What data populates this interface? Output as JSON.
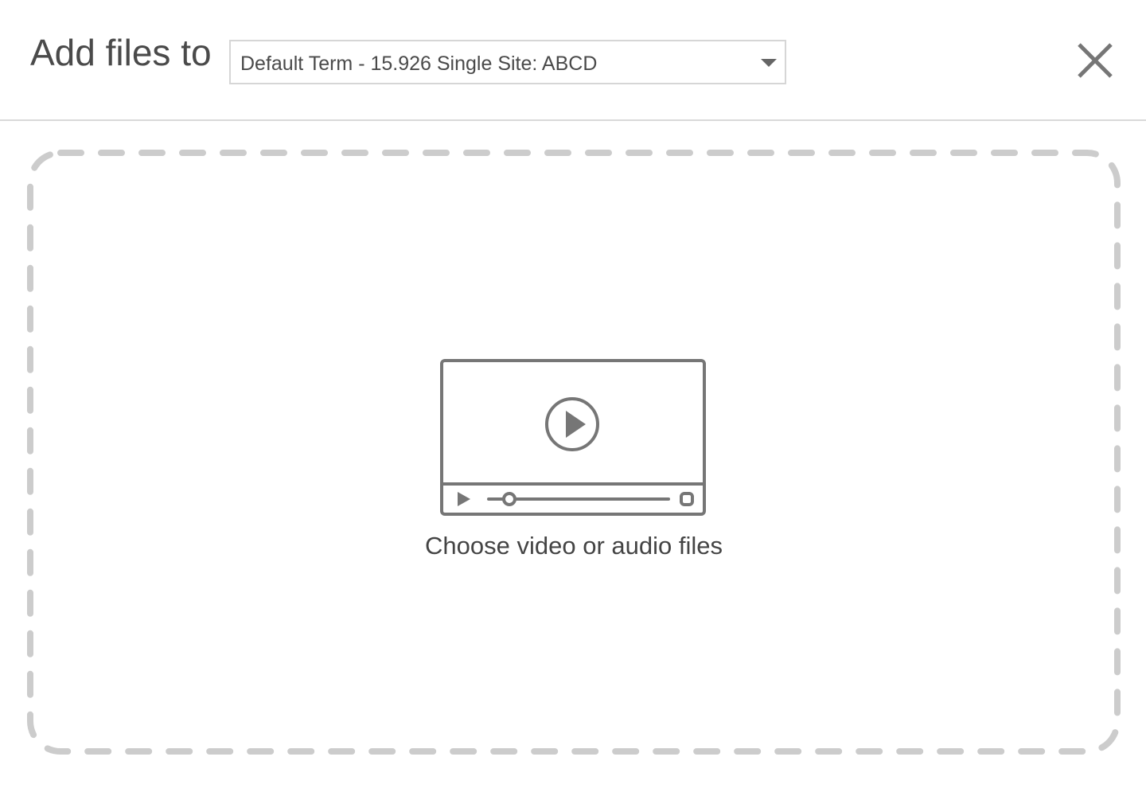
{
  "header": {
    "title": "Add files to",
    "destination_select": {
      "selected_value": "Default Term - 15.926 Single Site: ABCD"
    },
    "close_icon": "close-icon"
  },
  "dropzone": {
    "icon": "video-player-icon",
    "prompt": "Choose video or audio files"
  },
  "colors": {
    "title_text": "#4a4a4a",
    "icon_gray": "#767676",
    "dash_border": "#cccccc",
    "divider": "#d9d9d9"
  }
}
